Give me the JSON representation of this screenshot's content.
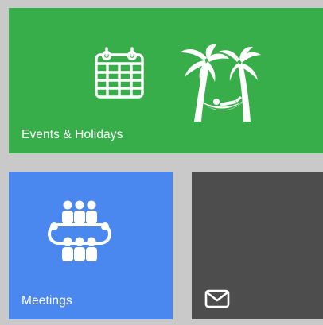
{
  "tiles": {
    "events": {
      "label": "Events & Holidays",
      "color": "#37ae49",
      "icons": [
        "calendar-icon",
        "palm-tree-hammock-icon"
      ]
    },
    "meetings": {
      "label": "Meetings",
      "color": "#4a87ef",
      "icons": [
        "meeting-group-icon"
      ]
    },
    "mail": {
      "label": "",
      "color": "#4d4d4d",
      "icons": [
        "envelope-icon"
      ]
    }
  },
  "colors": {
    "background": "#c9c9c9",
    "icon": "#ffffff"
  }
}
